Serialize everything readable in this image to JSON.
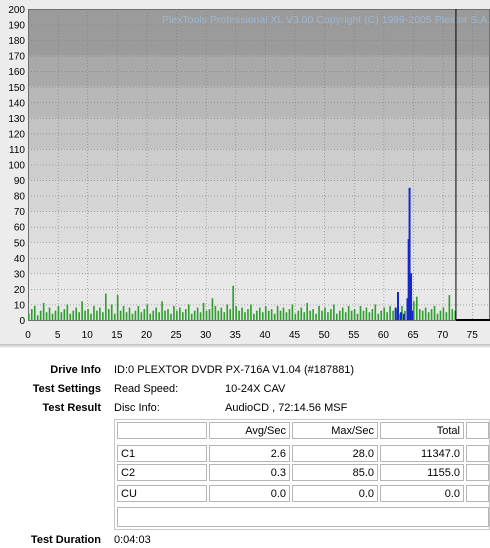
{
  "copyright": "PlexTools Professional XL V3.00 Copyright (C) 1999-2005 Plextor S.A.",
  "colors": {
    "c1_bars": "#2e9e2e",
    "c2_bars": "#1528c8",
    "marker_line": "#000000"
  },
  "chart_data": {
    "type": "bar",
    "x_ticks": [
      "0",
      "5",
      "10",
      "15",
      "20",
      "25",
      "30",
      "35",
      "40",
      "45",
      "50",
      "55",
      "60",
      "65",
      "70",
      "75"
    ],
    "y_ticks": [
      "0",
      "10",
      "20",
      "30",
      "40",
      "50",
      "60",
      "70",
      "80",
      "90",
      "100",
      "110",
      "120",
      "130",
      "140",
      "150",
      "160",
      "170",
      "180",
      "190",
      "200"
    ],
    "xlim": [
      0,
      78
    ],
    "ylim": [
      0,
      200
    ],
    "disc_end_minute": 72.25,
    "series": [
      {
        "values_sampled_every_0_5_min": [
          4,
          7,
          9,
          3,
          6,
          11,
          5,
          8,
          4,
          6,
          9,
          5,
          7,
          10,
          4,
          6,
          8,
          5,
          12,
          6,
          7,
          4,
          9,
          6,
          8,
          5,
          17,
          7,
          10,
          4,
          16,
          6,
          9,
          5,
          8,
          4,
          6,
          9,
          5,
          7,
          10,
          4,
          6,
          8,
          5,
          12,
          6,
          7,
          4,
          9,
          6,
          8,
          5,
          7,
          10,
          4,
          6,
          8,
          5,
          11,
          6,
          7,
          14,
          9,
          6,
          8,
          5,
          10,
          7,
          22,
          9,
          6,
          8,
          5,
          7,
          10,
          4,
          6,
          8,
          5,
          9,
          6,
          7,
          4,
          9,
          6,
          8,
          5,
          7,
          10,
          4,
          6,
          8,
          5,
          11,
          6,
          7,
          4,
          9,
          6,
          8,
          5,
          7,
          10,
          4,
          6,
          8,
          5,
          9,
          6,
          7,
          4,
          9,
          6,
          8,
          5,
          7,
          10,
          4,
          6,
          8,
          5,
          9,
          6,
          7,
          4,
          9,
          6,
          8,
          24,
          12,
          15,
          7,
          6,
          8,
          5,
          7,
          9,
          4,
          6,
          8,
          5,
          16,
          7,
          6,
          9
        ]
      },
      {
        "values_at_minute": [
          [
            61.9,
            8
          ],
          [
            62.3,
            18
          ],
          [
            62.8,
            5
          ],
          [
            63.3,
            4
          ],
          [
            63.9,
            14
          ],
          [
            64.1,
            52
          ],
          [
            64.25,
            85
          ],
          [
            64.5,
            30
          ],
          [
            64.7,
            6
          ]
        ]
      }
    ]
  },
  "drive_info": {
    "label": "Drive Info",
    "value": "ID:0 PLEXTOR DVDR PX-716A V1.04 (#187881)"
  },
  "test_settings": {
    "label": "Test Settings",
    "key": "Read Speed:",
    "value": "10-24X CAV"
  },
  "test_result": {
    "label": "Test Result",
    "key": "Disc Info:",
    "value": "AudioCD , 72:14.56 MSF"
  },
  "table": {
    "headers": [
      "",
      "Avg/Sec",
      "Max/Sec",
      "Total"
    ],
    "rows": [
      [
        "C1",
        "2.6",
        "28.0",
        "11347.0"
      ],
      [
        "C2",
        "0.3",
        "85.0",
        "1155.0"
      ],
      [
        "CU",
        "0.0",
        "0.0",
        "0.0"
      ]
    ]
  },
  "test_duration": {
    "label": "Test Duration",
    "value": "0:04:03"
  }
}
